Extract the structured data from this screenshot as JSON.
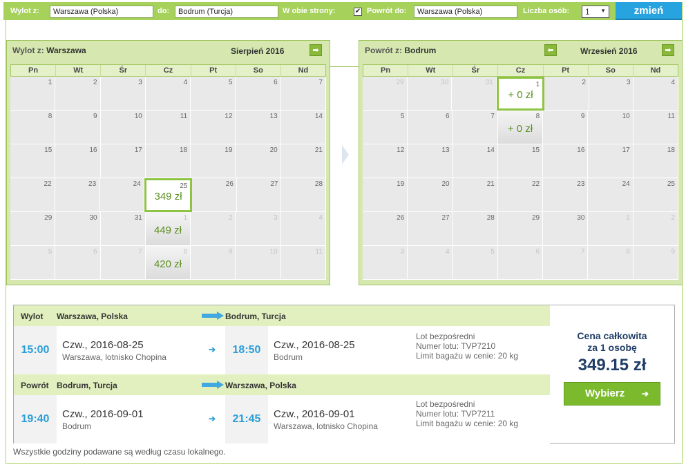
{
  "search": {
    "from_label": "Wylot z:",
    "from_value": "Warszawa (Polska)",
    "to_label": "do:",
    "to_value": "Bodrum (Turcja)",
    "roundtrip_label": "W obie strony:",
    "roundtrip_checked": "✔",
    "return_label": "Powrót do:",
    "return_value": "Warszawa (Polska)",
    "pax_label": "Liczba osób:",
    "pax_value": "1",
    "submit_label": "zmień"
  },
  "calendars": [
    {
      "title_prefix": "Wylot z:",
      "title_city": "Warszawa",
      "month": "Sierpień 2016",
      "dow": [
        "Pn",
        "Wt",
        "Śr",
        "Cz",
        "Pt",
        "So",
        "Nd"
      ],
      "weeks": [
        [
          {
            "d": "1"
          },
          {
            "d": "2"
          },
          {
            "d": "3"
          },
          {
            "d": "4"
          },
          {
            "d": "5"
          },
          {
            "d": "6"
          },
          {
            "d": "7"
          }
        ],
        [
          {
            "d": "8"
          },
          {
            "d": "9"
          },
          {
            "d": "10"
          },
          {
            "d": "11"
          },
          {
            "d": "12"
          },
          {
            "d": "13"
          },
          {
            "d": "14"
          }
        ],
        [
          {
            "d": "15"
          },
          {
            "d": "16"
          },
          {
            "d": "17"
          },
          {
            "d": "18"
          },
          {
            "d": "19"
          },
          {
            "d": "20"
          },
          {
            "d": "21"
          }
        ],
        [
          {
            "d": "22"
          },
          {
            "d": "23"
          },
          {
            "d": "24"
          },
          {
            "d": "25",
            "price": "349 zł",
            "selected": true
          },
          {
            "d": "26"
          },
          {
            "d": "27"
          },
          {
            "d": "28"
          }
        ],
        [
          {
            "d": "29"
          },
          {
            "d": "30"
          },
          {
            "d": "31"
          },
          {
            "d": "1",
            "out": true,
            "price": "449 zł"
          },
          {
            "d": "2",
            "out": true
          },
          {
            "d": "3",
            "out": true
          },
          {
            "d": "4",
            "out": true
          }
        ],
        [
          {
            "d": "5",
            "out": true
          },
          {
            "d": "6",
            "out": true
          },
          {
            "d": "7",
            "out": true
          },
          {
            "d": "8",
            "out": true,
            "price": "420 zł"
          },
          {
            "d": "9",
            "out": true
          },
          {
            "d": "10",
            "out": true
          },
          {
            "d": "11",
            "out": true
          }
        ]
      ]
    },
    {
      "title_prefix": "Powrót z:",
      "title_city": "Bodrum",
      "month": "Wrzesień 2016",
      "dow": [
        "Pn",
        "Wt",
        "Śr",
        "Cz",
        "Pt",
        "So",
        "Nd"
      ],
      "weeks": [
        [
          {
            "d": "29",
            "out": true
          },
          {
            "d": "30",
            "out": true
          },
          {
            "d": "31",
            "out": true
          },
          {
            "d": "1",
            "price": "+ 0 zł",
            "selected": true
          },
          {
            "d": "2"
          },
          {
            "d": "3"
          },
          {
            "d": "4"
          }
        ],
        [
          {
            "d": "5"
          },
          {
            "d": "6"
          },
          {
            "d": "7"
          },
          {
            "d": "8",
            "price": "+ 0 zł"
          },
          {
            "d": "9"
          },
          {
            "d": "10"
          },
          {
            "d": "11"
          }
        ],
        [
          {
            "d": "12"
          },
          {
            "d": "13"
          },
          {
            "d": "14"
          },
          {
            "d": "15"
          },
          {
            "d": "16"
          },
          {
            "d": "17"
          },
          {
            "d": "18"
          }
        ],
        [
          {
            "d": "19"
          },
          {
            "d": "20"
          },
          {
            "d": "21"
          },
          {
            "d": "22"
          },
          {
            "d": "23"
          },
          {
            "d": "24"
          },
          {
            "d": "25"
          }
        ],
        [
          {
            "d": "26"
          },
          {
            "d": "27"
          },
          {
            "d": "28"
          },
          {
            "d": "29"
          },
          {
            "d": "30"
          },
          {
            "d": "1",
            "out": true
          },
          {
            "d": "2",
            "out": true
          }
        ],
        [
          {
            "d": "3",
            "out": true
          },
          {
            "d": "4",
            "out": true
          },
          {
            "d": "5",
            "out": true
          },
          {
            "d": "6",
            "out": true
          },
          {
            "d": "7",
            "out": true
          },
          {
            "d": "8",
            "out": true
          },
          {
            "d": "9",
            "out": true
          }
        ]
      ]
    }
  ],
  "legs": [
    {
      "kind": "Wylot",
      "from": "Warszawa, Polska",
      "to": "Bodrum, Turcja",
      "dep_time": "15:00",
      "dep_date": "Czw., 2016-08-25",
      "dep_place": "Warszawa, lotnisko Chopina",
      "arr_time": "18:50",
      "arr_date": "Czw., 2016-08-25",
      "arr_place": "Bodrum",
      "info_direct": "Lot bezpośredni",
      "info_flight": "Numer lotu: TVP7210",
      "info_baggage": "Limit bagażu w cenie: 20 kg"
    },
    {
      "kind": "Powrót",
      "from": "Bodrum, Turcja",
      "to": "Warszawa, Polska",
      "dep_time": "19:40",
      "dep_date": "Czw., 2016-09-01",
      "dep_place": "Bodrum",
      "arr_time": "21:45",
      "arr_date": "Czw., 2016-09-01",
      "arr_place": "Warszawa, lotnisko Chopina",
      "info_direct": "Lot bezpośredni",
      "info_flight": "Numer lotu: TVP7211",
      "info_baggage": "Limit bagażu w cenie: 20 kg"
    }
  ],
  "price": {
    "label_line1": "Cena całkowita",
    "label_line2": "za 1 osobę",
    "total": "349.15 zł",
    "choose_label": "Wybierz"
  },
  "footnote": "Wszystkie godziny podawane są według czasu lokalnego.",
  "colors": {
    "accent_green": "#a6d15a",
    "button_blue": "#27a3e0",
    "time_blue": "#2a9ed8",
    "price_navy": "#1f3d66",
    "choose_green": "#7cba2d"
  }
}
